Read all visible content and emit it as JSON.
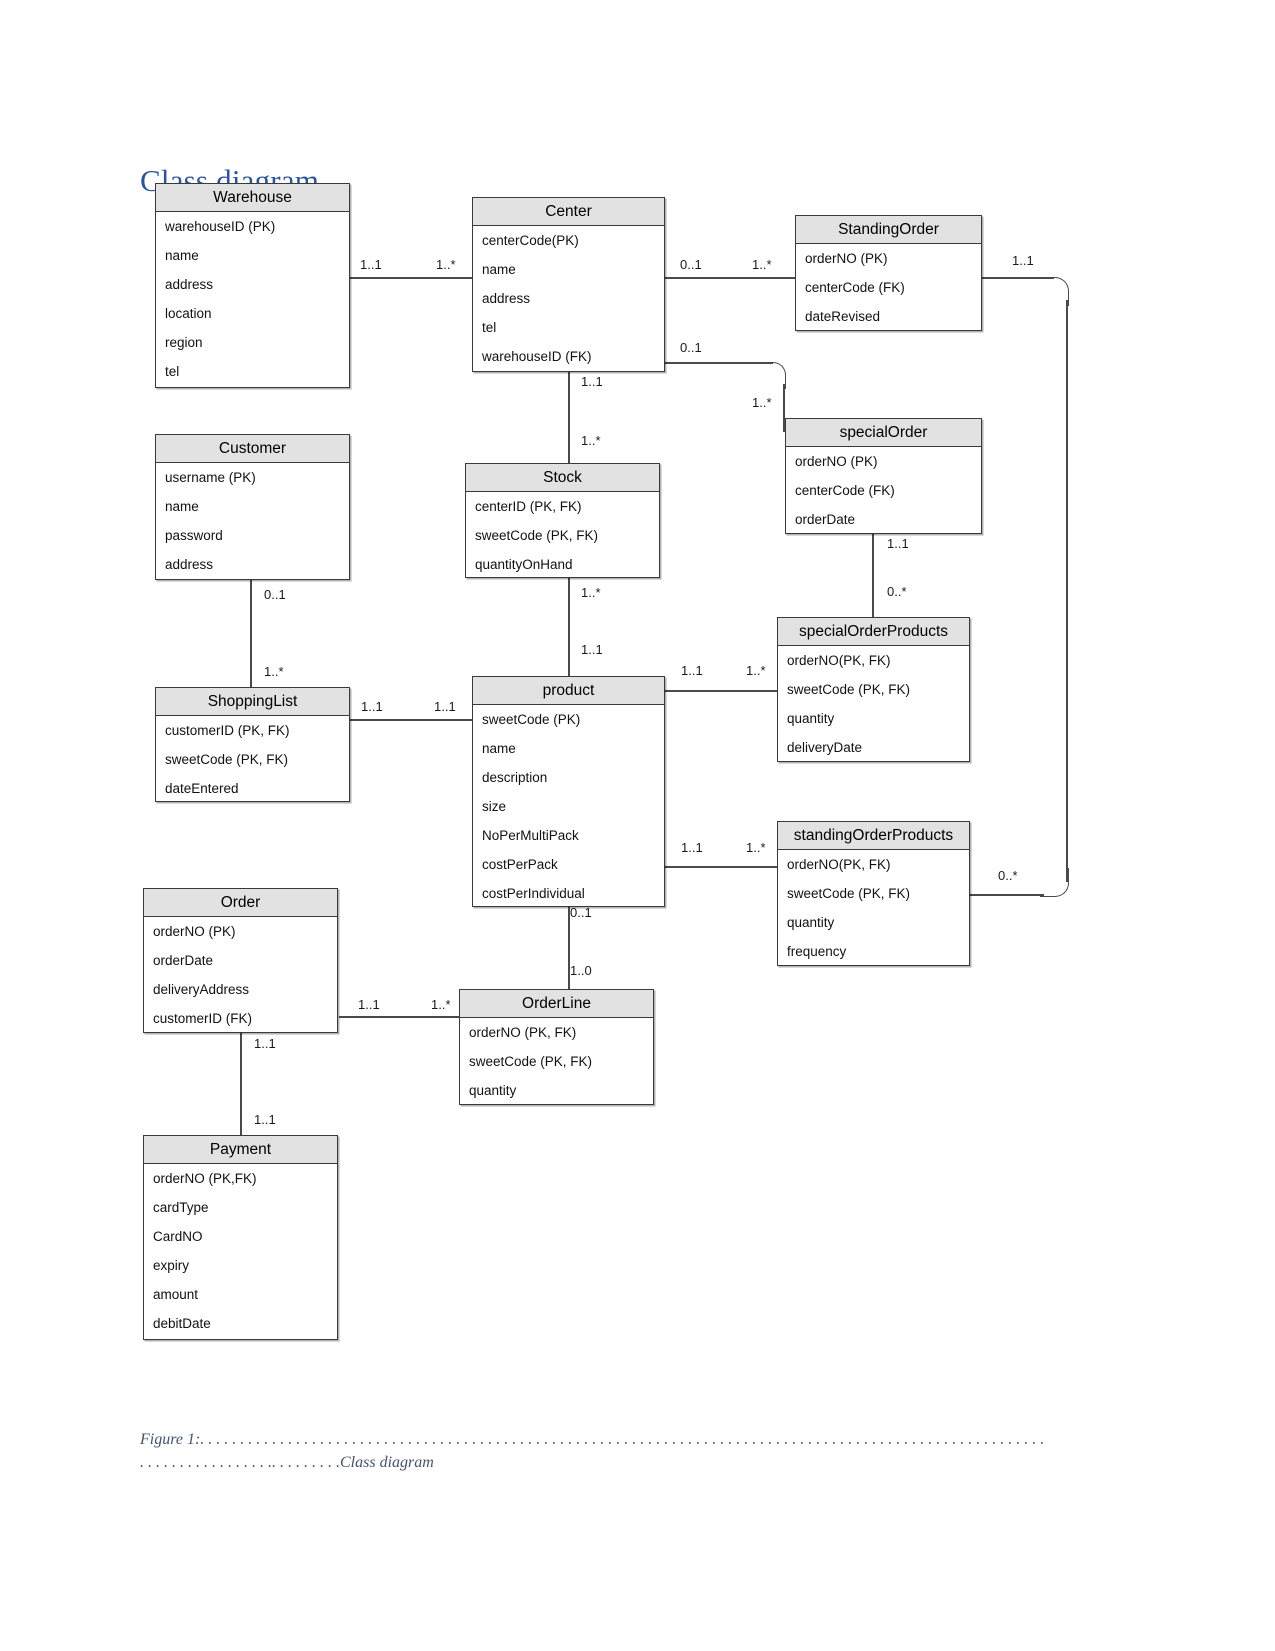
{
  "page": {
    "title": "Class diagram",
    "caption_prefix": "Figure 1:",
    "caption_leader": ". . . . . . . . . . . . . . . . . . . . . . . . . . . . . . . . . . . . . . . . . . . . . . . . . . . . . . . . . . . . . . . . . . . . . . . . . . . . . . . . . . . . . . . . . . . . . . . . . . . . . . . . . . . . . . . . . . . . . . . . . . .. . . . . . . . .",
    "caption_text": "Class diagram",
    "accent_color": "#2e5496",
    "caption_color": "#44546a",
    "header_fill": "#e2e2e2",
    "border_color": "#3a3a3a"
  },
  "classes": [
    {
      "id": "warehouse",
      "name": "Warehouse",
      "attributes": [
        "warehouseID (PK)",
        "name",
        "address",
        "location",
        "region",
        "tel"
      ]
    },
    {
      "id": "center",
      "name": "Center",
      "attributes": [
        "centerCode(PK)",
        "name",
        "address",
        "tel",
        "warehouseID (FK)"
      ]
    },
    {
      "id": "standingOrder",
      "name": "StandingOrder",
      "attributes": [
        "orderNO (PK)",
        "centerCode (FK)",
        "dateRevised"
      ]
    },
    {
      "id": "customer",
      "name": "Customer",
      "attributes": [
        "username (PK)",
        "name",
        "password",
        "address"
      ]
    },
    {
      "id": "stock",
      "name": "Stock",
      "attributes": [
        "centerID (PK, FK)",
        "sweetCode (PK, FK)",
        "quantityOnHand"
      ]
    },
    {
      "id": "specialOrder",
      "name": "specialOrder",
      "attributes": [
        "orderNO (PK)",
        "centerCode (FK)",
        "orderDate"
      ]
    },
    {
      "id": "specialOrderProducts",
      "name": "specialOrderProducts",
      "attributes": [
        "orderNO(PK, FK)",
        "sweetCode (PK, FK)",
        "quantity",
        "deliveryDate"
      ]
    },
    {
      "id": "shoppingList",
      "name": "ShoppingList",
      "attributes": [
        "customerID (PK, FK)",
        "sweetCode (PK, FK)",
        "dateEntered"
      ]
    },
    {
      "id": "product",
      "name": "product",
      "attributes": [
        "sweetCode (PK)",
        "name",
        "description",
        "size",
        "NoPerMultiPack",
        "costPerPack",
        "costPerIndividual"
      ]
    },
    {
      "id": "standingOrderProducts",
      "name": "standingOrderProducts",
      "attributes": [
        "orderNO(PK, FK)",
        "sweetCode (PK, FK)",
        "quantity",
        "frequency"
      ]
    },
    {
      "id": "order",
      "name": "Order",
      "attributes": [
        "orderNO (PK)",
        "orderDate",
        "deliveryAddress",
        "customerID (FK)"
      ]
    },
    {
      "id": "orderLine",
      "name": "OrderLine",
      "attributes": [
        "orderNO (PK, FK)",
        "sweetCode (PK, FK)",
        "quantity"
      ]
    },
    {
      "id": "payment",
      "name": "Payment",
      "attributes": [
        "orderNO (PK,FK)",
        "cardType",
        "CardNO",
        "expiry",
        "amount",
        "debitDate"
      ]
    }
  ],
  "multiplicities": {
    "warehouse_center_left": "1..1",
    "warehouse_center_right": "1..*",
    "center_standingorder_left": "0..1",
    "center_standingorder_right": "1..*",
    "center_specialorder_left": "0..1",
    "center_specialorder_right": "1..*",
    "standingorder_right": "1..1",
    "center_stock_top": "1..1",
    "center_stock_bottom": "1..*",
    "specialorder_products_top": "1..1",
    "specialorder_products_bottom": "0..*",
    "customer_shoppinglist_top": "0..1",
    "customer_shoppinglist_bottom": "1..*",
    "stock_product_top": "1..*",
    "stock_product_bottom": "1..1",
    "product_sop_left": "1..1",
    "product_sop_right": "1..*",
    "shoppinglist_product_left": "1..1",
    "shoppinglist_product_right": "1..1",
    "product_standingop_left": "1..1",
    "product_standingop_right": "1..*",
    "standingop_right": "0..*",
    "product_orderline_top": "0..1",
    "product_orderline_bottom": "1..0",
    "order_orderline_left": "1..1",
    "order_orderline_right": "1..*",
    "order_payment_top": "1..1",
    "order_payment_bottom": "1..1"
  }
}
